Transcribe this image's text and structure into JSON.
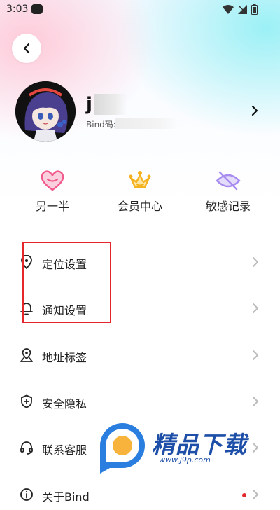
{
  "status_bar": {
    "time": "3:03"
  },
  "profile": {
    "name": "j",
    "bind_label": "Bind码:"
  },
  "quick_actions": [
    {
      "label": "另一半",
      "icon": "heart-icon",
      "color": "#f15a8a"
    },
    {
      "label": "会员中心",
      "icon": "crown-icon",
      "color": "#f4b21f"
    },
    {
      "label": "敏感记录",
      "icon": "eye-off-icon",
      "color": "#a78bf0"
    }
  ],
  "menu": [
    {
      "label": "定位设置",
      "icon": "location-pin-icon"
    },
    {
      "label": "通知设置",
      "icon": "bell-icon"
    },
    {
      "label": "地址标签",
      "icon": "map-pin-icon"
    },
    {
      "label": "安全隐私",
      "icon": "shield-icon"
    },
    {
      "label": "联系客服",
      "icon": "headset-icon"
    },
    {
      "label": "关于Bind",
      "icon": "info-icon",
      "has_badge": true
    }
  ],
  "watermark": {
    "title": "精品下载",
    "url": "www.j9p.com"
  },
  "colors": {
    "highlight": "#e5262c",
    "badge": "#e5262c",
    "watermark": "#1e4fa8"
  }
}
